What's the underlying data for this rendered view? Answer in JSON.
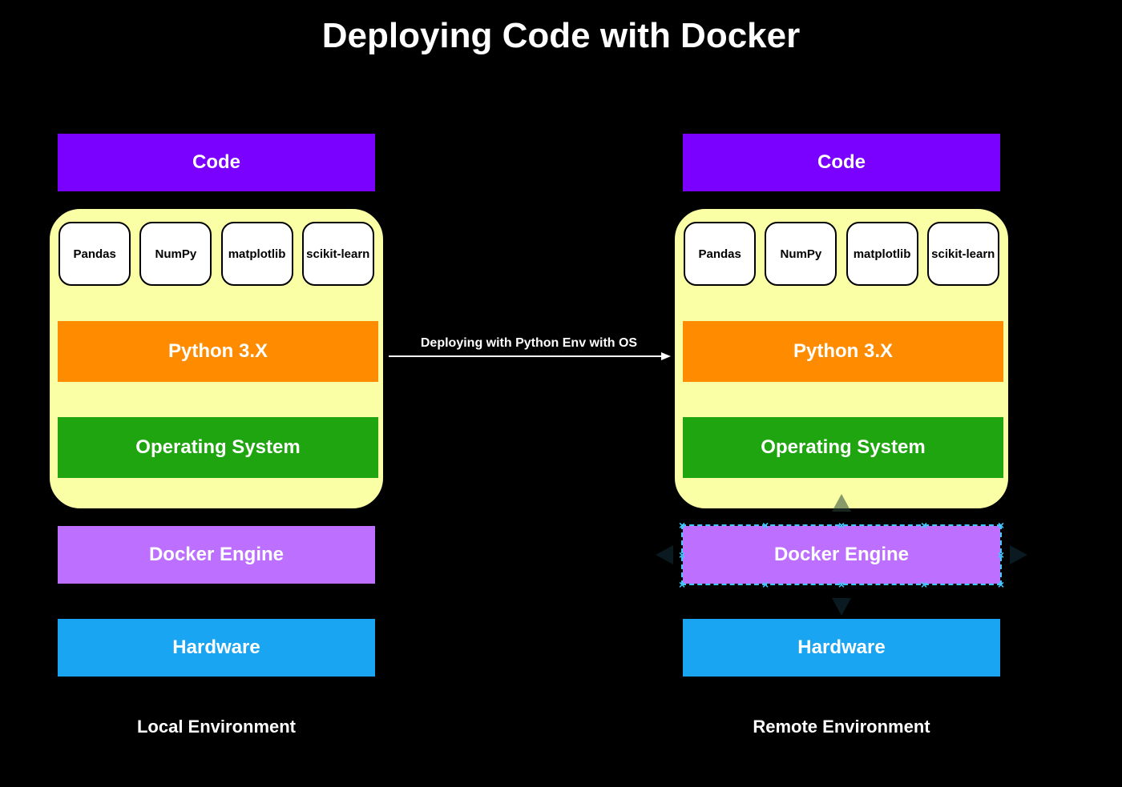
{
  "title": "Deploying Code with Docker",
  "arrow_label": "Deploying with Python Env with OS",
  "left": {
    "code": "Code",
    "libs": [
      "Pandas",
      "NumPy",
      "matplotlib",
      "scikit-learn"
    ],
    "python": "Python 3.X",
    "os": "Operating System",
    "docker": "Docker Engine",
    "hw": "Hardware",
    "label": "Local Environment"
  },
  "right": {
    "code": "Code",
    "libs": [
      "Pandas",
      "NumPy",
      "matplotlib",
      "scikit-learn"
    ],
    "python": "Python 3.X",
    "os": "Operating System",
    "docker": "Docker Engine",
    "hw": "Hardware",
    "label": "Remote Environment",
    "docker_selected": true
  },
  "colors": {
    "code": "#7a00ff",
    "container_bg": "#faffa5",
    "python": "#ff8c00",
    "os": "#1ea50f",
    "docker": "#bd70ff",
    "hardware": "#1aa5f2",
    "selection": "#42c8ff"
  }
}
